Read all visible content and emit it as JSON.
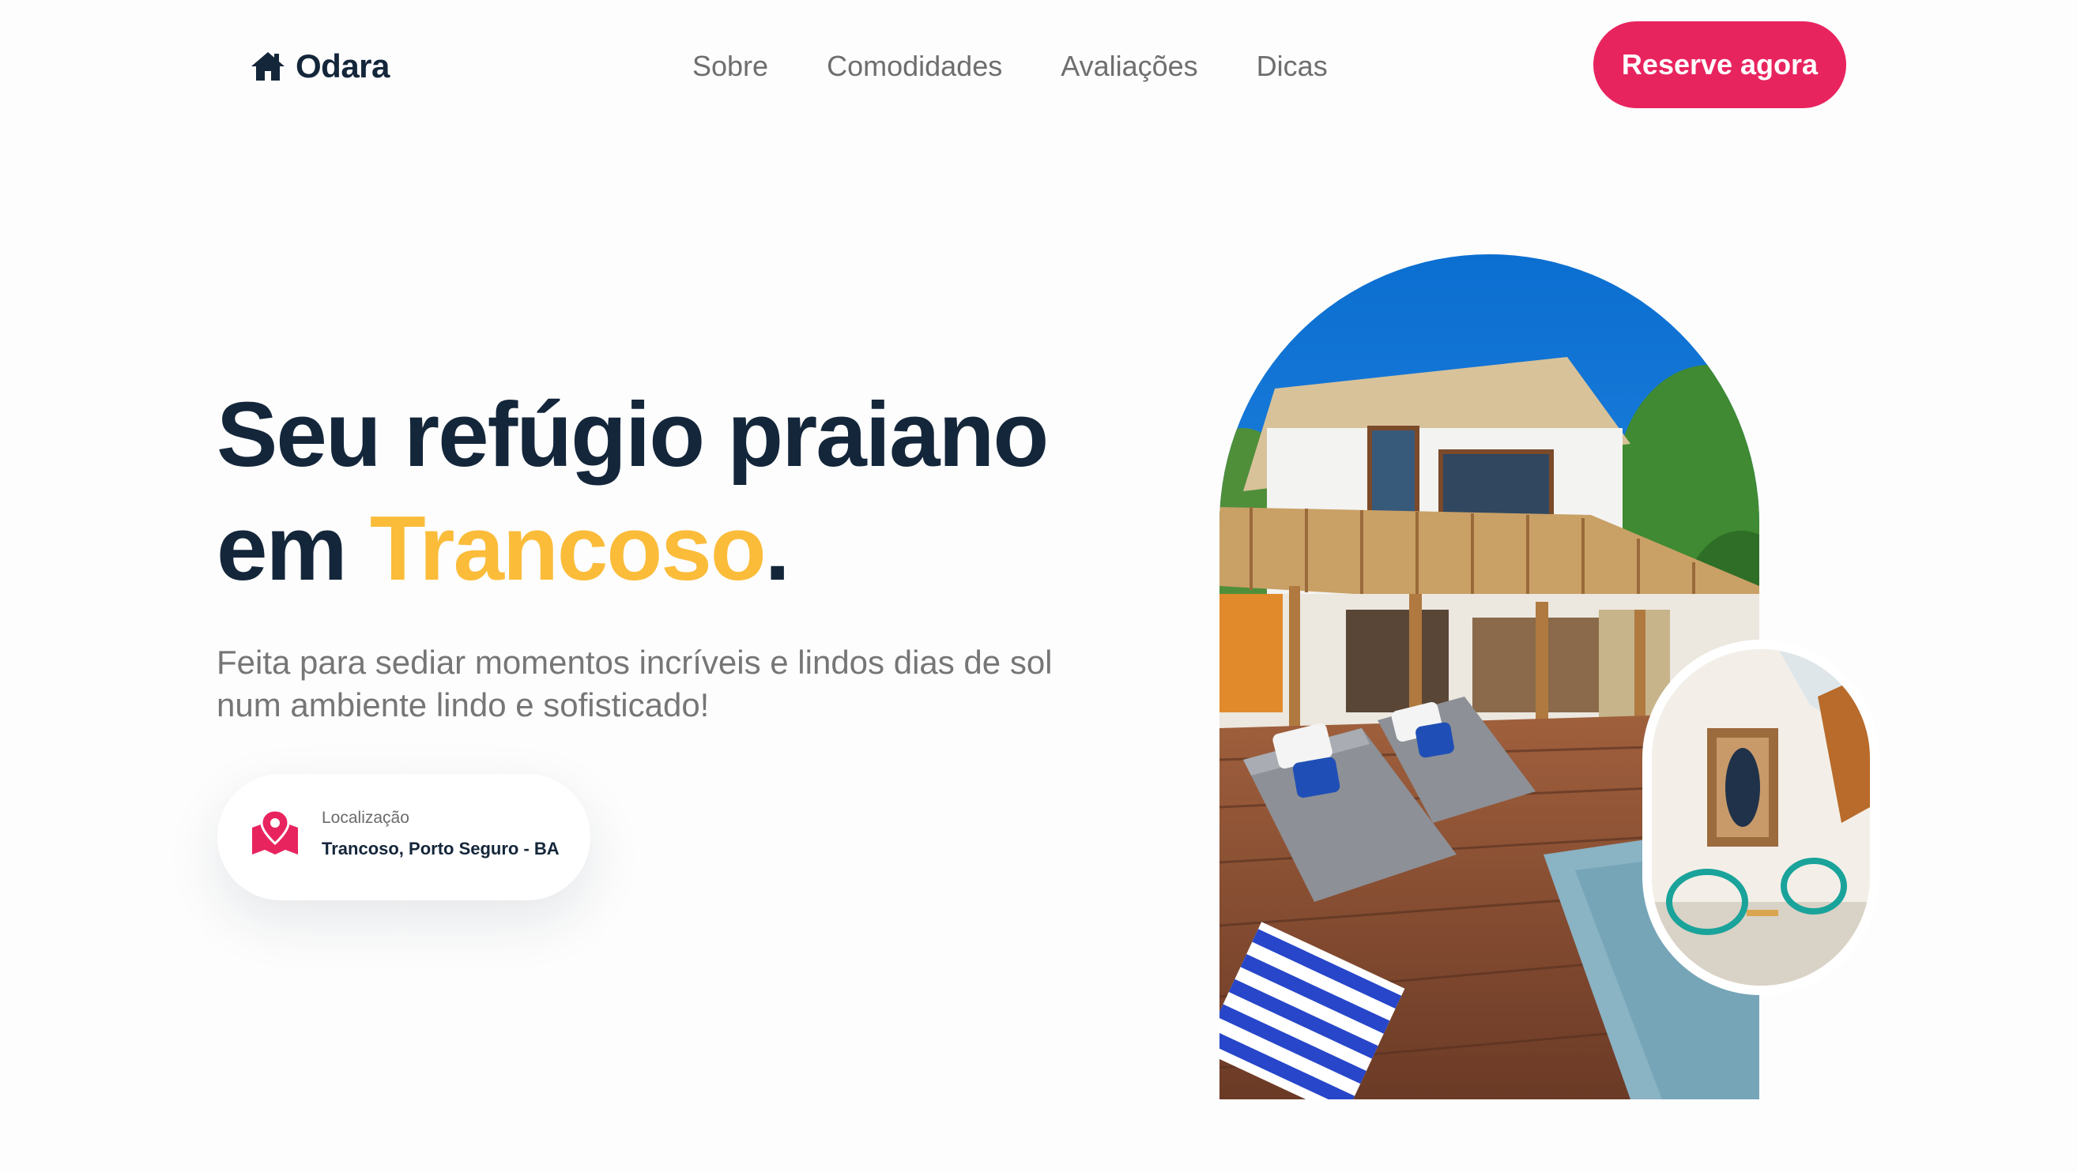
{
  "brand": {
    "name": "Odara",
    "icon": "home-icon"
  },
  "nav": {
    "items": [
      {
        "label": "Sobre"
      },
      {
        "label": "Comodidades"
      },
      {
        "label": "Avaliações"
      },
      {
        "label": "Dicas"
      }
    ]
  },
  "header": {
    "cta_label": "Reserve agora"
  },
  "hero": {
    "title_line1": "Seu refúgio praiano",
    "title_line2_prefix": "em ",
    "title_highlight": "Trancoso",
    "title_line2_suffix": ".",
    "subtitle": "Feita para sediar momentos incríveis e lindos dias de sol num ambiente lindo e sofisticado!"
  },
  "location": {
    "label": "Localização",
    "value": "Trancoso, Porto Seguro - BA",
    "icon": "map-pin-icon"
  },
  "colors": {
    "primary": "#e8245f",
    "accent": "#fbbc3a",
    "heading": "#14263a",
    "body_text": "#767676",
    "nav_text": "#6e6e6e"
  }
}
